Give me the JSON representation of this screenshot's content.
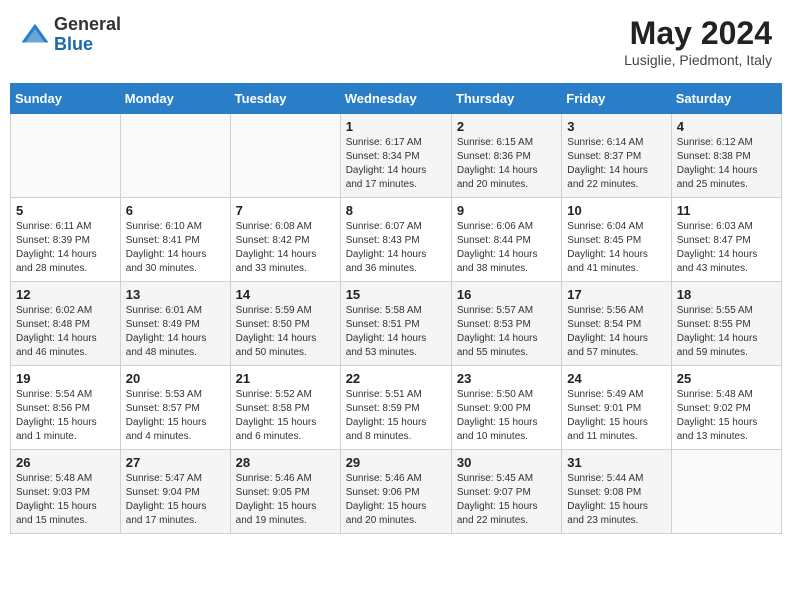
{
  "header": {
    "logo_general": "General",
    "logo_blue": "Blue",
    "month_year": "May 2024",
    "location": "Lusiglie, Piedmont, Italy"
  },
  "weekdays": [
    "Sunday",
    "Monday",
    "Tuesday",
    "Wednesday",
    "Thursday",
    "Friday",
    "Saturday"
  ],
  "weeks": [
    [
      {
        "day": "",
        "info": ""
      },
      {
        "day": "",
        "info": ""
      },
      {
        "day": "",
        "info": ""
      },
      {
        "day": "1",
        "info": "Sunrise: 6:17 AM\nSunset: 8:34 PM\nDaylight: 14 hours\nand 17 minutes."
      },
      {
        "day": "2",
        "info": "Sunrise: 6:15 AM\nSunset: 8:36 PM\nDaylight: 14 hours\nand 20 minutes."
      },
      {
        "day": "3",
        "info": "Sunrise: 6:14 AM\nSunset: 8:37 PM\nDaylight: 14 hours\nand 22 minutes."
      },
      {
        "day": "4",
        "info": "Sunrise: 6:12 AM\nSunset: 8:38 PM\nDaylight: 14 hours\nand 25 minutes."
      }
    ],
    [
      {
        "day": "5",
        "info": "Sunrise: 6:11 AM\nSunset: 8:39 PM\nDaylight: 14 hours\nand 28 minutes."
      },
      {
        "day": "6",
        "info": "Sunrise: 6:10 AM\nSunset: 8:41 PM\nDaylight: 14 hours\nand 30 minutes."
      },
      {
        "day": "7",
        "info": "Sunrise: 6:08 AM\nSunset: 8:42 PM\nDaylight: 14 hours\nand 33 minutes."
      },
      {
        "day": "8",
        "info": "Sunrise: 6:07 AM\nSunset: 8:43 PM\nDaylight: 14 hours\nand 36 minutes."
      },
      {
        "day": "9",
        "info": "Sunrise: 6:06 AM\nSunset: 8:44 PM\nDaylight: 14 hours\nand 38 minutes."
      },
      {
        "day": "10",
        "info": "Sunrise: 6:04 AM\nSunset: 8:45 PM\nDaylight: 14 hours\nand 41 minutes."
      },
      {
        "day": "11",
        "info": "Sunrise: 6:03 AM\nSunset: 8:47 PM\nDaylight: 14 hours\nand 43 minutes."
      }
    ],
    [
      {
        "day": "12",
        "info": "Sunrise: 6:02 AM\nSunset: 8:48 PM\nDaylight: 14 hours\nand 46 minutes."
      },
      {
        "day": "13",
        "info": "Sunrise: 6:01 AM\nSunset: 8:49 PM\nDaylight: 14 hours\nand 48 minutes."
      },
      {
        "day": "14",
        "info": "Sunrise: 5:59 AM\nSunset: 8:50 PM\nDaylight: 14 hours\nand 50 minutes."
      },
      {
        "day": "15",
        "info": "Sunrise: 5:58 AM\nSunset: 8:51 PM\nDaylight: 14 hours\nand 53 minutes."
      },
      {
        "day": "16",
        "info": "Sunrise: 5:57 AM\nSunset: 8:53 PM\nDaylight: 14 hours\nand 55 minutes."
      },
      {
        "day": "17",
        "info": "Sunrise: 5:56 AM\nSunset: 8:54 PM\nDaylight: 14 hours\nand 57 minutes."
      },
      {
        "day": "18",
        "info": "Sunrise: 5:55 AM\nSunset: 8:55 PM\nDaylight: 14 hours\nand 59 minutes."
      }
    ],
    [
      {
        "day": "19",
        "info": "Sunrise: 5:54 AM\nSunset: 8:56 PM\nDaylight: 15 hours\nand 1 minute."
      },
      {
        "day": "20",
        "info": "Sunrise: 5:53 AM\nSunset: 8:57 PM\nDaylight: 15 hours\nand 4 minutes."
      },
      {
        "day": "21",
        "info": "Sunrise: 5:52 AM\nSunset: 8:58 PM\nDaylight: 15 hours\nand 6 minutes."
      },
      {
        "day": "22",
        "info": "Sunrise: 5:51 AM\nSunset: 8:59 PM\nDaylight: 15 hours\nand 8 minutes."
      },
      {
        "day": "23",
        "info": "Sunrise: 5:50 AM\nSunset: 9:00 PM\nDaylight: 15 hours\nand 10 minutes."
      },
      {
        "day": "24",
        "info": "Sunrise: 5:49 AM\nSunset: 9:01 PM\nDaylight: 15 hours\nand 11 minutes."
      },
      {
        "day": "25",
        "info": "Sunrise: 5:48 AM\nSunset: 9:02 PM\nDaylight: 15 hours\nand 13 minutes."
      }
    ],
    [
      {
        "day": "26",
        "info": "Sunrise: 5:48 AM\nSunset: 9:03 PM\nDaylight: 15 hours\nand 15 minutes."
      },
      {
        "day": "27",
        "info": "Sunrise: 5:47 AM\nSunset: 9:04 PM\nDaylight: 15 hours\nand 17 minutes."
      },
      {
        "day": "28",
        "info": "Sunrise: 5:46 AM\nSunset: 9:05 PM\nDaylight: 15 hours\nand 19 minutes."
      },
      {
        "day": "29",
        "info": "Sunrise: 5:46 AM\nSunset: 9:06 PM\nDaylight: 15 hours\nand 20 minutes."
      },
      {
        "day": "30",
        "info": "Sunrise: 5:45 AM\nSunset: 9:07 PM\nDaylight: 15 hours\nand 22 minutes."
      },
      {
        "day": "31",
        "info": "Sunrise: 5:44 AM\nSunset: 9:08 PM\nDaylight: 15 hours\nand 23 minutes."
      },
      {
        "day": "",
        "info": ""
      }
    ]
  ]
}
